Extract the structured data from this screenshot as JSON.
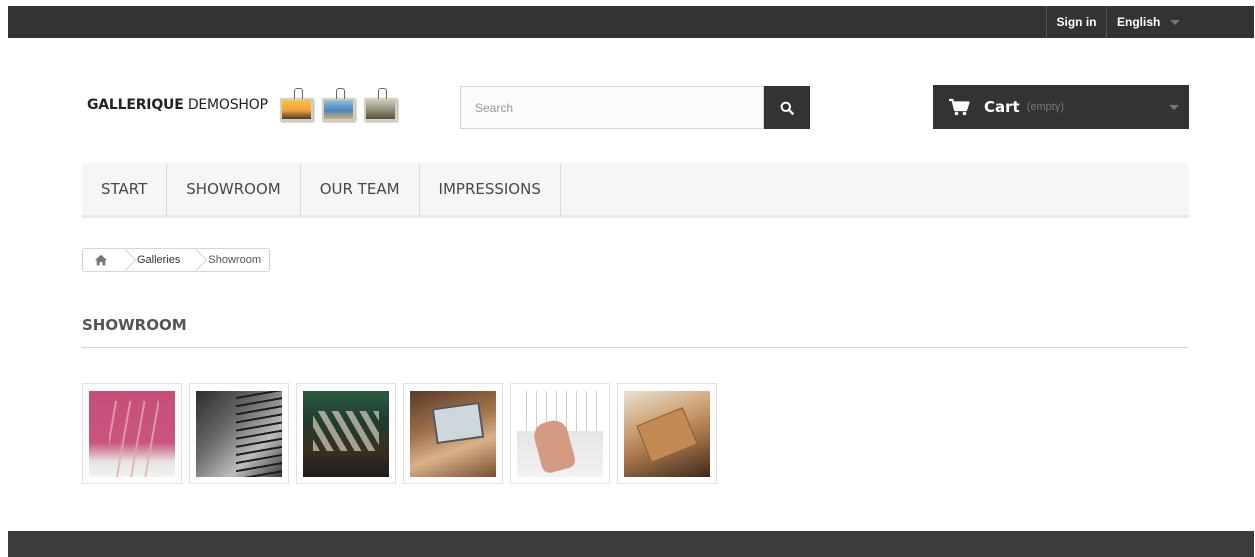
{
  "topbar": {
    "signin_label": "Sign in",
    "language_label": "English"
  },
  "header": {
    "logo_bold": "GALLERIQUE",
    "logo_rest": " DEMOSHOP",
    "search": {
      "placeholder": "Search",
      "icon": "search-icon"
    },
    "cart": {
      "label": "Cart",
      "status": "(empty)",
      "icon": "cart-icon"
    }
  },
  "menu": {
    "items": [
      {
        "label": "START"
      },
      {
        "label": "SHOWROOM"
      },
      {
        "label": "OUR TEAM"
      },
      {
        "label": "IMPRESSIONS"
      }
    ]
  },
  "breadcrumb": {
    "home_icon": "home-icon",
    "items": [
      {
        "label": "Galleries"
      },
      {
        "label": "Showroom"
      }
    ]
  },
  "page": {
    "heading": "SHOWROOM"
  },
  "gallery": {
    "thumbnails": [
      {
        "subject": "pink flowers"
      },
      {
        "subject": "staircase interior"
      },
      {
        "subject": "clothes on hangers"
      },
      {
        "subject": "tablet and coffee"
      },
      {
        "subject": "hand on keyboard"
      },
      {
        "subject": "wooden notebook"
      }
    ]
  },
  "colors": {
    "topbar_bg": "#333333",
    "menu_bg": "#f6f6f6",
    "footer_bg": "#3c3c3c",
    "accent_dark": "#333333"
  }
}
